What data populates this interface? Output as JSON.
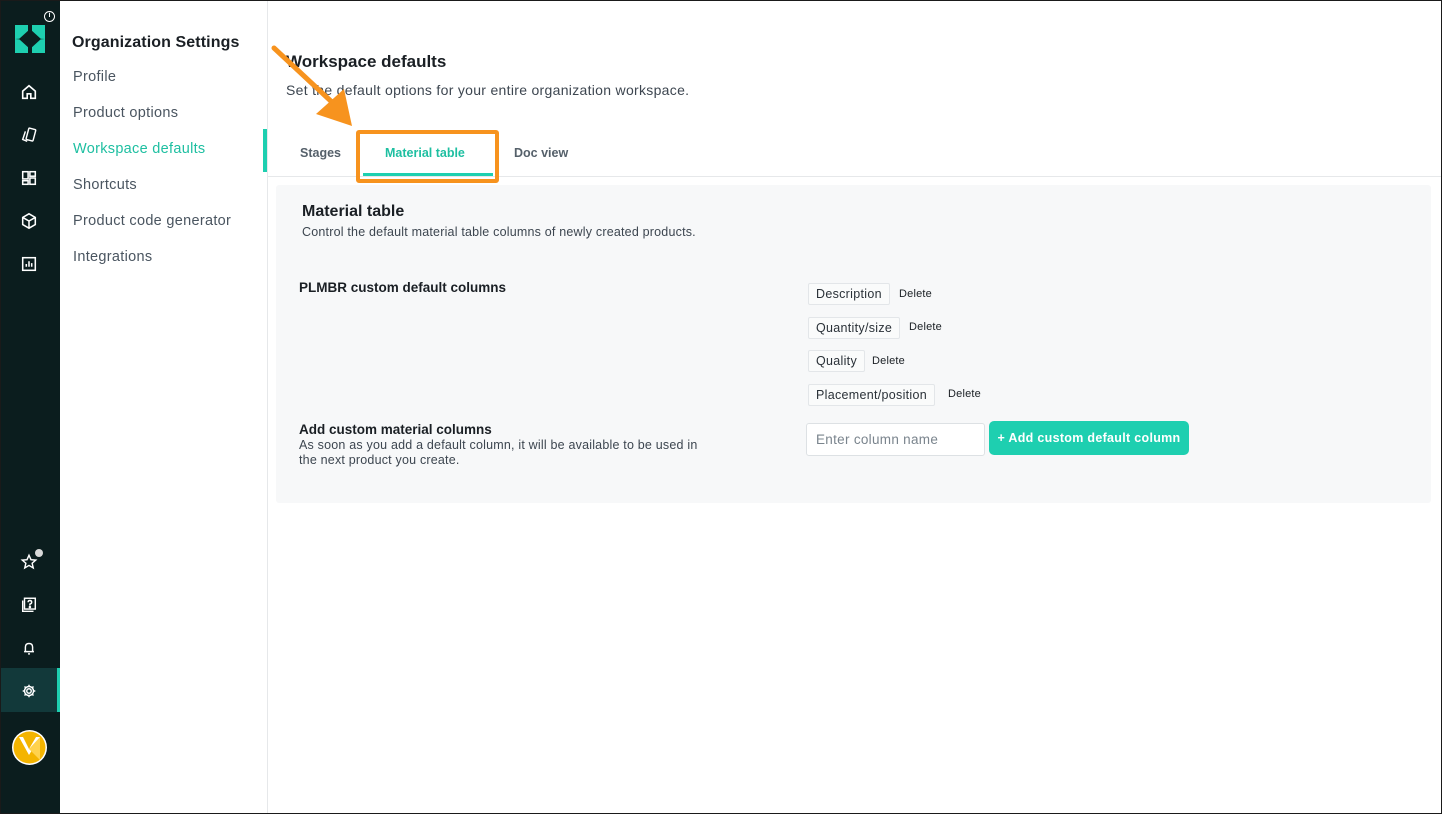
{
  "rail": {
    "icons": [
      "home-icon",
      "products-icon",
      "dashboard-icon",
      "materials-icon",
      "reports-icon",
      "star-icon",
      "help-icon",
      "bell-icon",
      "gear-icon"
    ],
    "info_glyph": "i"
  },
  "settings": {
    "title": "Organization Settings",
    "items": [
      {
        "label": "Profile"
      },
      {
        "label": "Product options"
      },
      {
        "label": "Workspace defaults"
      },
      {
        "label": "Shortcuts"
      },
      {
        "label": "Product code generator"
      },
      {
        "label": "Integrations"
      }
    ],
    "active_index": 2
  },
  "main": {
    "title": "Workspace defaults",
    "subtitle": "Set the default options for your entire organization workspace."
  },
  "tabs": [
    {
      "label": "Stages"
    },
    {
      "label": "Material table"
    },
    {
      "label": "Doc view"
    }
  ],
  "active_tab": 1,
  "panel": {
    "title": "Material table",
    "subtitle": "Control the default material table columns of newly created products.",
    "default_columns_label": "PLMBR custom default columns",
    "columns": [
      {
        "name": "Description",
        "action": "Delete"
      },
      {
        "name": "Quantity/size",
        "action": "Delete"
      },
      {
        "name": "Quality",
        "action": "Delete"
      },
      {
        "name": "Placement/position",
        "action": "Delete"
      }
    ],
    "add_label": "Add custom material columns",
    "add_description": "As soon as you add a default column, it will be available to be used in the next product you create.",
    "input_placeholder": "Enter column name",
    "add_button": "+ Add custom default column"
  },
  "colors": {
    "accent": "#1ecfb0",
    "rail": "#0b1d1e",
    "annotation": "#f7931e"
  }
}
